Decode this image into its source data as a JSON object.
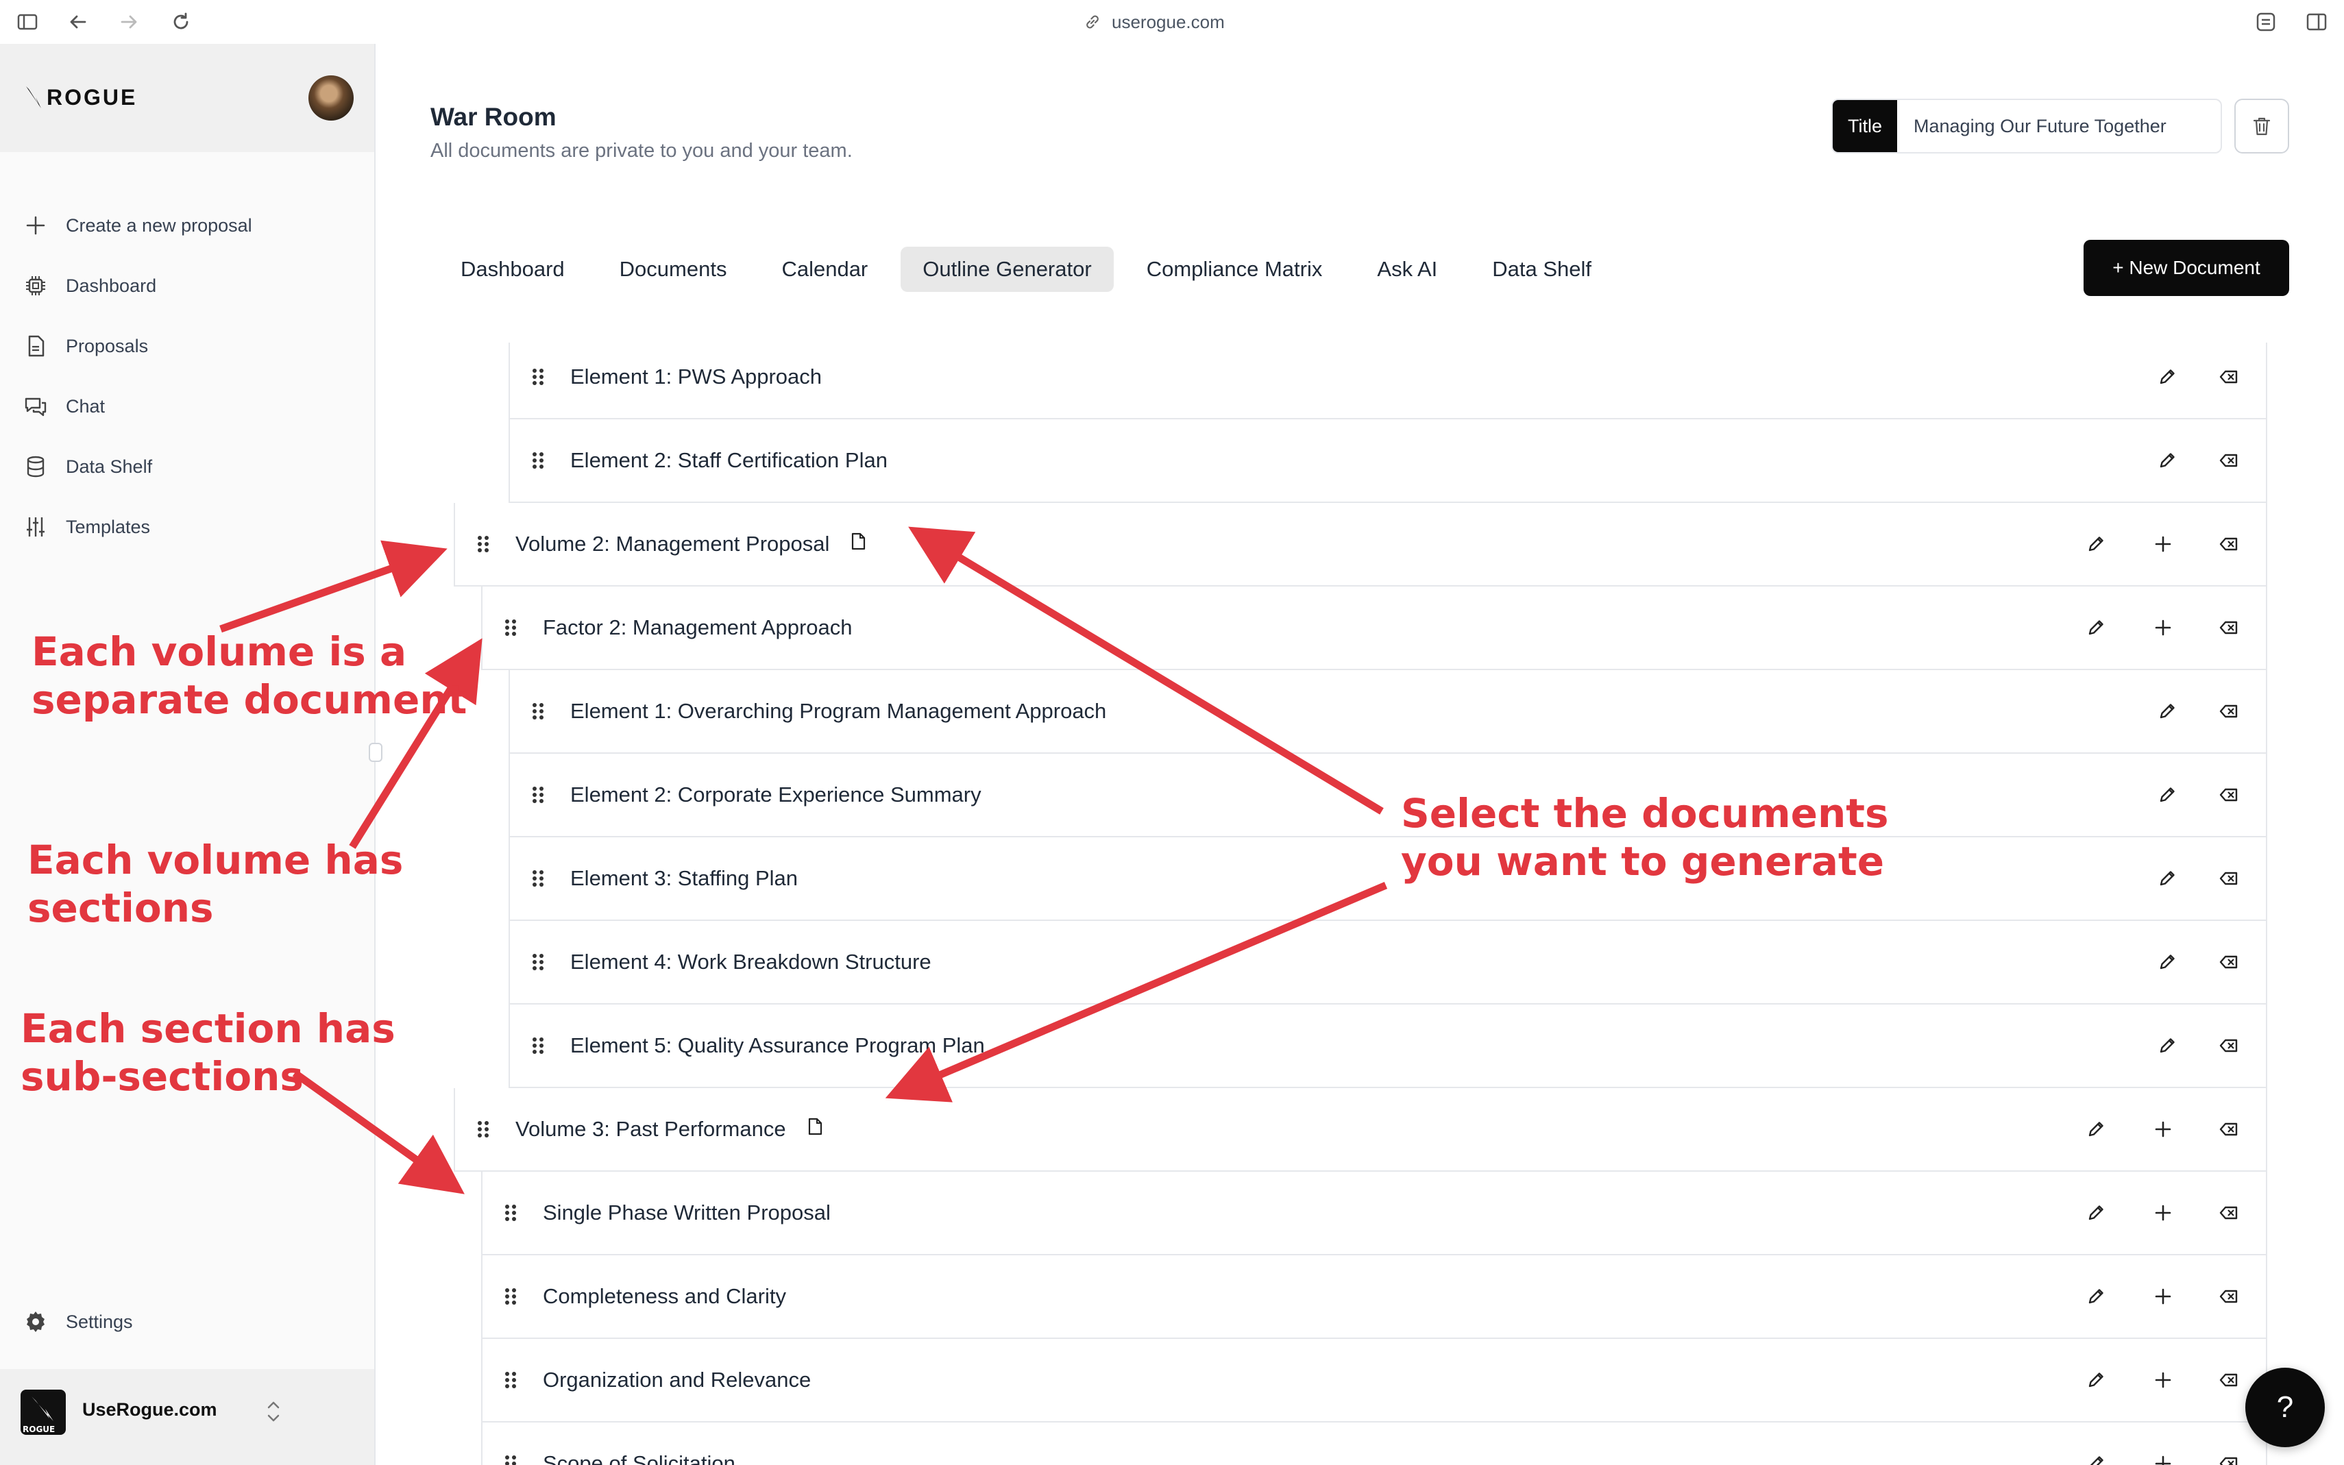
{
  "browser": {
    "url": "userogue.com"
  },
  "sidebar": {
    "logo_text": "ROGUE",
    "items": [
      {
        "label": "Create a new proposal",
        "icon": "plus-icon"
      },
      {
        "label": "Dashboard",
        "icon": "chip-icon"
      },
      {
        "label": "Proposals",
        "icon": "document-icon"
      },
      {
        "label": "Chat",
        "icon": "chat-icon"
      },
      {
        "label": "Data Shelf",
        "icon": "database-icon"
      },
      {
        "label": "Templates",
        "icon": "sliders-icon"
      }
    ],
    "settings_label": "Settings",
    "org_name": "UseRogue.com",
    "org_logo_text": "ROGUE"
  },
  "header": {
    "title": "War Room",
    "subtitle": "All documents are private to you and your team.",
    "title_tag": "Title",
    "title_value": "Managing Our Future Together"
  },
  "tabs": [
    {
      "label": "Dashboard",
      "active": false
    },
    {
      "label": "Documents",
      "active": false
    },
    {
      "label": "Calendar",
      "active": false
    },
    {
      "label": "Outline Generator",
      "active": true
    },
    {
      "label": "Compliance Matrix",
      "active": false
    },
    {
      "label": "Ask AI",
      "active": false
    },
    {
      "label": "Data Shelf",
      "active": false
    }
  ],
  "new_document_label": "+ New Document",
  "outline": [
    {
      "label": "Element 1: PWS Approach",
      "level": "element"
    },
    {
      "label": "Element 2: Staff Certification Plan",
      "level": "element"
    },
    {
      "label": "Volume 2: Management Proposal",
      "level": "volume"
    },
    {
      "label": "Factor 2: Management Approach",
      "level": "section"
    },
    {
      "label": "Element 1: Overarching Program Management Approach",
      "level": "element"
    },
    {
      "label": "Element 2: Corporate Experience Summary",
      "level": "element"
    },
    {
      "label": "Element 3: Staffing Plan",
      "level": "element"
    },
    {
      "label": "Element 4: Work Breakdown Structure",
      "level": "element"
    },
    {
      "label": "Element 5: Quality Assurance Program Plan",
      "level": "element"
    },
    {
      "label": "Volume 3: Past Performance",
      "level": "volume"
    },
    {
      "label": "Single Phase Written Proposal",
      "level": "section"
    },
    {
      "label": "Completeness and Clarity",
      "level": "section"
    },
    {
      "label": "Organization and Relevance",
      "level": "section"
    },
    {
      "label": "Scope of Solicitation",
      "level": "section"
    }
  ],
  "annotations": {
    "volume_doc_1": "Each volume is a",
    "volume_doc_2": "separate document",
    "volume_sections_1": "Each volume has",
    "volume_sections_2": "sections",
    "section_sub_1": "Each section has",
    "section_sub_2": "sub-sections",
    "select_1": "Select the documents",
    "select_2": "you want to generate"
  },
  "help_label": "?",
  "colors": {
    "accent": "#e2373f",
    "dark": "#0b0b0b",
    "active_tab": "#e8e8e8"
  }
}
